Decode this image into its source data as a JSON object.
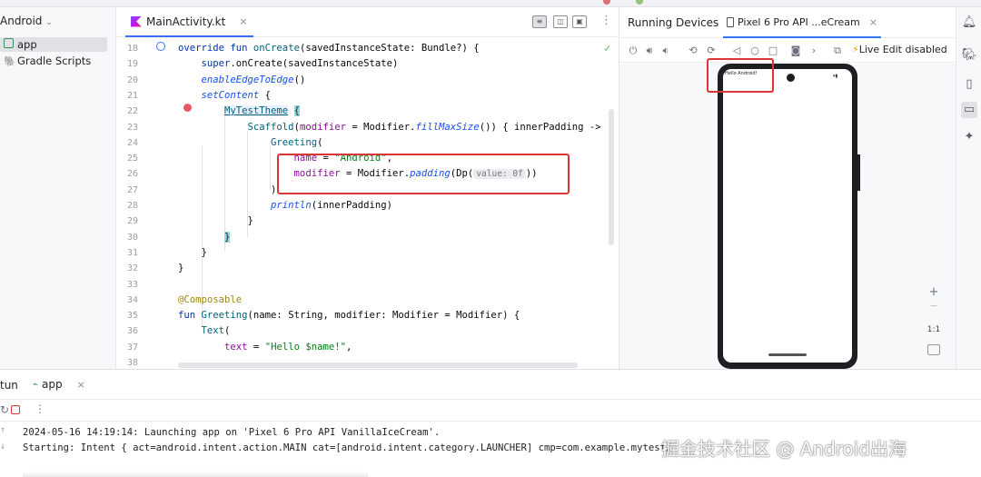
{
  "project": {
    "header_label": "Android",
    "items": [
      {
        "label": "app"
      },
      {
        "label": "Gradle Scripts"
      }
    ]
  },
  "editor": {
    "tab_label": "MainActivity.kt",
    "line_numbers": [
      "18",
      "19",
      "20",
      "21",
      "22",
      "23",
      "24",
      "25",
      "26",
      "27",
      "28",
      "29",
      "30",
      "31",
      "32",
      "33",
      "34",
      "35",
      "36",
      "37",
      "38"
    ],
    "lines": [
      [
        {
          "t": "override fun ",
          "c": "kw"
        },
        {
          "t": "onCreate",
          "c": "fn"
        },
        {
          "t": "(savedInstanceState: Bundle?) {",
          "c": "txt"
        }
      ],
      [
        {
          "t": "    super",
          "c": "kw"
        },
        {
          "t": ".onCreate(savedInstanceState)",
          "c": "txt"
        }
      ],
      [
        {
          "t": "    enableEdgeToEdge",
          "c": "it"
        },
        {
          "t": "()",
          "c": "txt"
        }
      ],
      [
        {
          "t": "    setContent",
          "c": "it"
        },
        {
          "t": " {",
          "c": "txt"
        }
      ],
      [
        {
          "t": "        ",
          "c": "txt"
        },
        {
          "t": "MyTestTheme",
          "c": "theme-link"
        },
        {
          "t": " ",
          "c": "txt"
        },
        {
          "t": "{",
          "c": "brace-hl"
        }
      ],
      [
        {
          "t": "            Scaffold",
          "c": "fn"
        },
        {
          "t": "(",
          "c": "txt"
        },
        {
          "t": "modifier",
          "c": "pn"
        },
        {
          "t": " = Modifier.",
          "c": "txt"
        },
        {
          "t": "fillMaxSize",
          "c": "it"
        },
        {
          "t": "()) { innerPadding ->",
          "c": "txt"
        }
      ],
      [
        {
          "t": "                Greeting",
          "c": "fn"
        },
        {
          "t": "(",
          "c": "txt"
        }
      ],
      [
        {
          "t": "                    name",
          "c": "pn"
        },
        {
          "t": " = ",
          "c": "txt"
        },
        {
          "t": "\"Android\"",
          "c": "st"
        },
        {
          "t": ",",
          "c": "txt"
        }
      ],
      [
        {
          "t": "                    modifier",
          "c": "pn"
        },
        {
          "t": " = Modifier.",
          "c": "txt"
        },
        {
          "t": "padding",
          "c": "it"
        },
        {
          "t": "(Dp(",
          "c": "txt"
        },
        {
          "t": "value: 0f",
          "c": "hint"
        },
        {
          "t": "))",
          "c": "txt"
        }
      ],
      [
        {
          "t": "                )",
          "c": "txt"
        }
      ],
      [
        {
          "t": "                println",
          "c": "it"
        },
        {
          "t": "(innerPadding)",
          "c": "txt"
        }
      ],
      [
        {
          "t": "            }",
          "c": "txt"
        }
      ],
      [
        {
          "t": "        ",
          "c": "txt"
        },
        {
          "t": "}",
          "c": "brace-hl"
        }
      ],
      [
        {
          "t": "    }",
          "c": "txt"
        }
      ],
      [
        {
          "t": "}",
          "c": "txt"
        }
      ],
      [
        {
          "t": "",
          "c": "txt"
        }
      ],
      [
        {
          "t": "@Composable",
          "c": "cm"
        }
      ],
      [
        {
          "t": "fun ",
          "c": "kw"
        },
        {
          "t": "Greeting",
          "c": "fn"
        },
        {
          "t": "(name: String, modifier: Modifier = Modifier) {",
          "c": "txt"
        }
      ],
      [
        {
          "t": "    Text",
          "c": "fn"
        },
        {
          "t": "(",
          "c": "txt"
        }
      ],
      [
        {
          "t": "        text",
          "c": "pn"
        },
        {
          "t": " = ",
          "c": "txt"
        },
        {
          "t": "\"Hello $name!\"",
          "c": "st"
        },
        {
          "t": ",",
          "c": "txt"
        }
      ],
      [
        {
          "t": "",
          "c": "txt"
        }
      ]
    ]
  },
  "devices": {
    "tab_running": "Running Devices",
    "tab_device": "Pixel 6 Pro API ...eCream",
    "live_edit": "Live Edit disabled",
    "phone_text": "Hello Android!",
    "zoom_label": "1:1",
    "zoom_in": "+"
  },
  "run": {
    "tab_prefix": "tun",
    "tab_label": "app",
    "console": [
      "2024-05-16 14:19:14: Launching app on 'Pixel 6 Pro API VanillaIceCream'.",
      "Starting: Intent { act=android.intent.action.MAIN cat=[android.intent.category.LAUNCHER] cmp=com.example.mytest/"
    ]
  },
  "watermark": "掘金技术社区 @ Android出海"
}
